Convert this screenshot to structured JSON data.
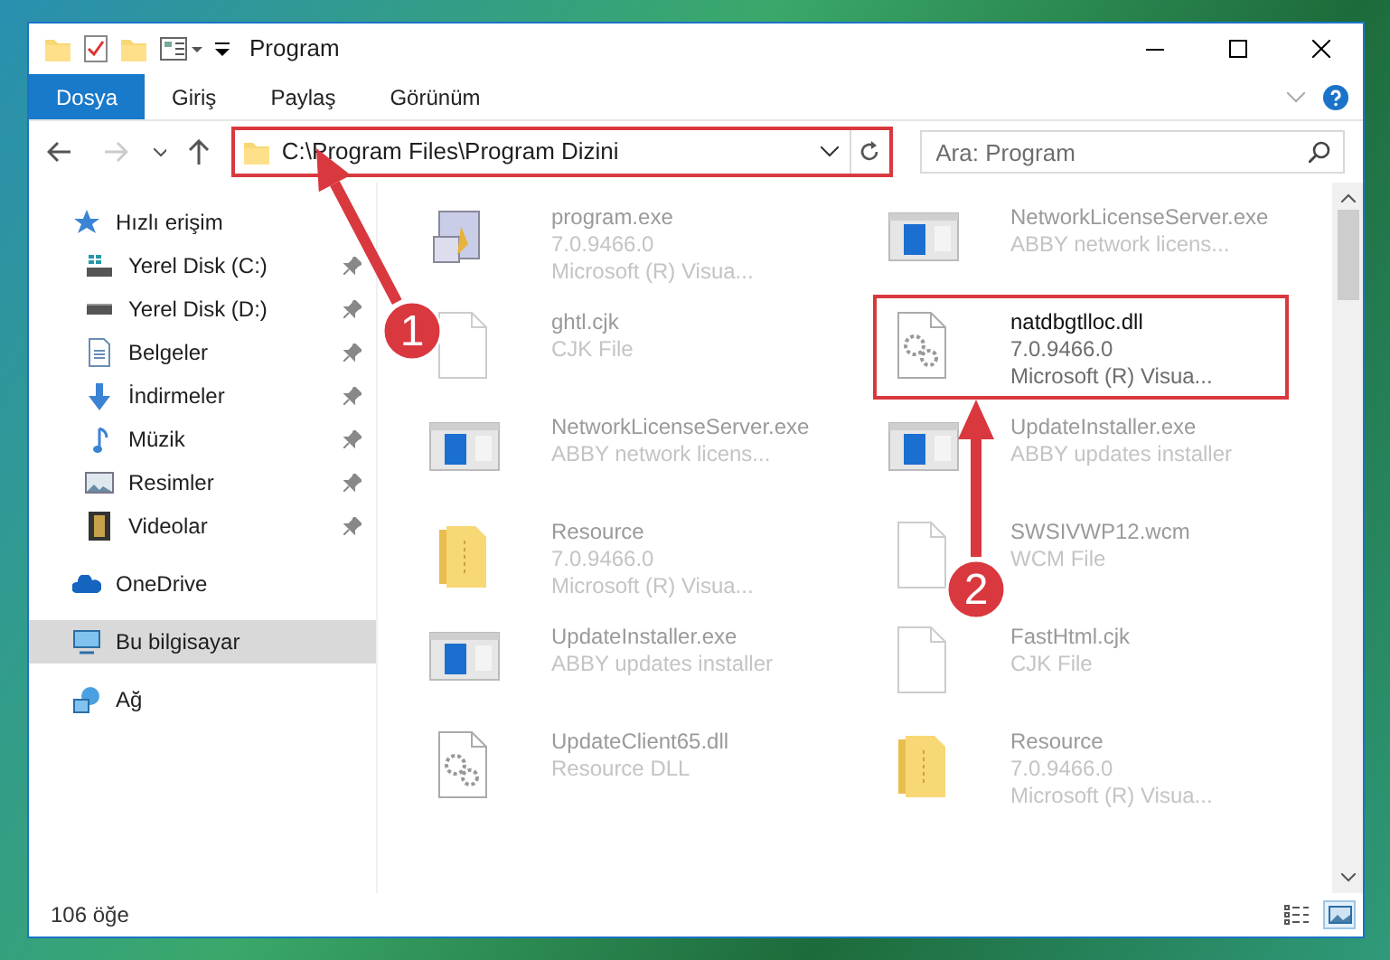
{
  "window": {
    "title": "Program"
  },
  "ribbon_tabs": [
    {
      "label": "Dosya",
      "selected": true
    },
    {
      "label": "Giriş",
      "selected": false
    },
    {
      "label": "Paylaş",
      "selected": false
    },
    {
      "label": "Görünüm",
      "selected": false
    }
  ],
  "address_bar": {
    "path": "C:\\Program Files\\Program Dizini",
    "highlighted": true
  },
  "search": {
    "placeholder": "Ara: Program"
  },
  "sidebar": {
    "items": [
      {
        "label": "Hızlı erişim",
        "selected": false,
        "children": [
          {
            "label": "Yerel Disk (C:)",
            "selected": false,
            "pinned": true
          },
          {
            "label": "Yerel Disk (D:)",
            "selected": false,
            "pinned": true
          },
          {
            "label": "Belgeler",
            "selected": false,
            "pinned": true
          },
          {
            "label": "İndirmeler",
            "selected": false,
            "pinned": true
          },
          {
            "label": "Müzik",
            "selected": false,
            "pinned": true
          },
          {
            "label": "Resimler",
            "selected": false,
            "pinned": true
          },
          {
            "label": "Videolar",
            "selected": false,
            "pinned": true
          }
        ]
      },
      {
        "label": "OneDrive",
        "selected": false
      },
      {
        "label": "Bu bilgisayar",
        "selected": true
      },
      {
        "label": "Ağ",
        "selected": false
      }
    ]
  },
  "files": [
    {
      "name": "program.exe",
      "kind": "setup",
      "details": [
        "7.0.9466.0",
        "Microsoft (R) Visua..."
      ],
      "highlighted": false
    },
    {
      "name": "NetworkLicenseServer.exe",
      "kind": "app",
      "details": [
        "ABBY network licens..."
      ],
      "highlighted": false
    },
    {
      "name": "ghtl.cjk",
      "kind": "file",
      "details": [
        "CJK File"
      ],
      "highlighted": false
    },
    {
      "name": "natdbgtlloc.dll",
      "kind": "dll",
      "details": [
        "7.0.9466.0",
        "Microsoft (R) Visua..."
      ],
      "highlighted": true
    },
    {
      "name": "NetworkLicenseServer.exe",
      "kind": "app",
      "details": [
        "ABBY network licens..."
      ],
      "highlighted": false
    },
    {
      "name": "UpdateInstaller.exe",
      "kind": "app",
      "details": [
        "ABBY updates installer"
      ],
      "highlighted": false
    },
    {
      "name": "Resource",
      "kind": "folder",
      "details": [
        "7.0.9466.0",
        "Microsoft (R) Visua..."
      ],
      "highlighted": false
    },
    {
      "name": "SWSIVWP12.wcm",
      "kind": "file",
      "details": [
        "WCM File"
      ],
      "highlighted": false
    },
    {
      "name": "UpdateInstaller.exe",
      "kind": "app",
      "details": [
        "ABBY updates installer"
      ],
      "highlighted": false
    },
    {
      "name": "FastHtml.cjk",
      "kind": "file",
      "details": [
        "CJK File"
      ],
      "highlighted": false
    },
    {
      "name": "UpdateClient65.dll",
      "kind": "dll",
      "details": [
        "Resource DLL"
      ],
      "highlighted": false
    },
    {
      "name": "Resource",
      "kind": "folder",
      "details": [
        "7.0.9466.0",
        "Microsoft (R) Visua..."
      ],
      "highlighted": false
    }
  ],
  "status_bar": {
    "item_count": "106 öğe",
    "views": [
      {
        "kind": "details",
        "selected": false
      },
      {
        "kind": "large-icons",
        "selected": true
      }
    ]
  },
  "annotations": [
    {
      "label": "1"
    },
    {
      "label": "2"
    }
  ]
}
